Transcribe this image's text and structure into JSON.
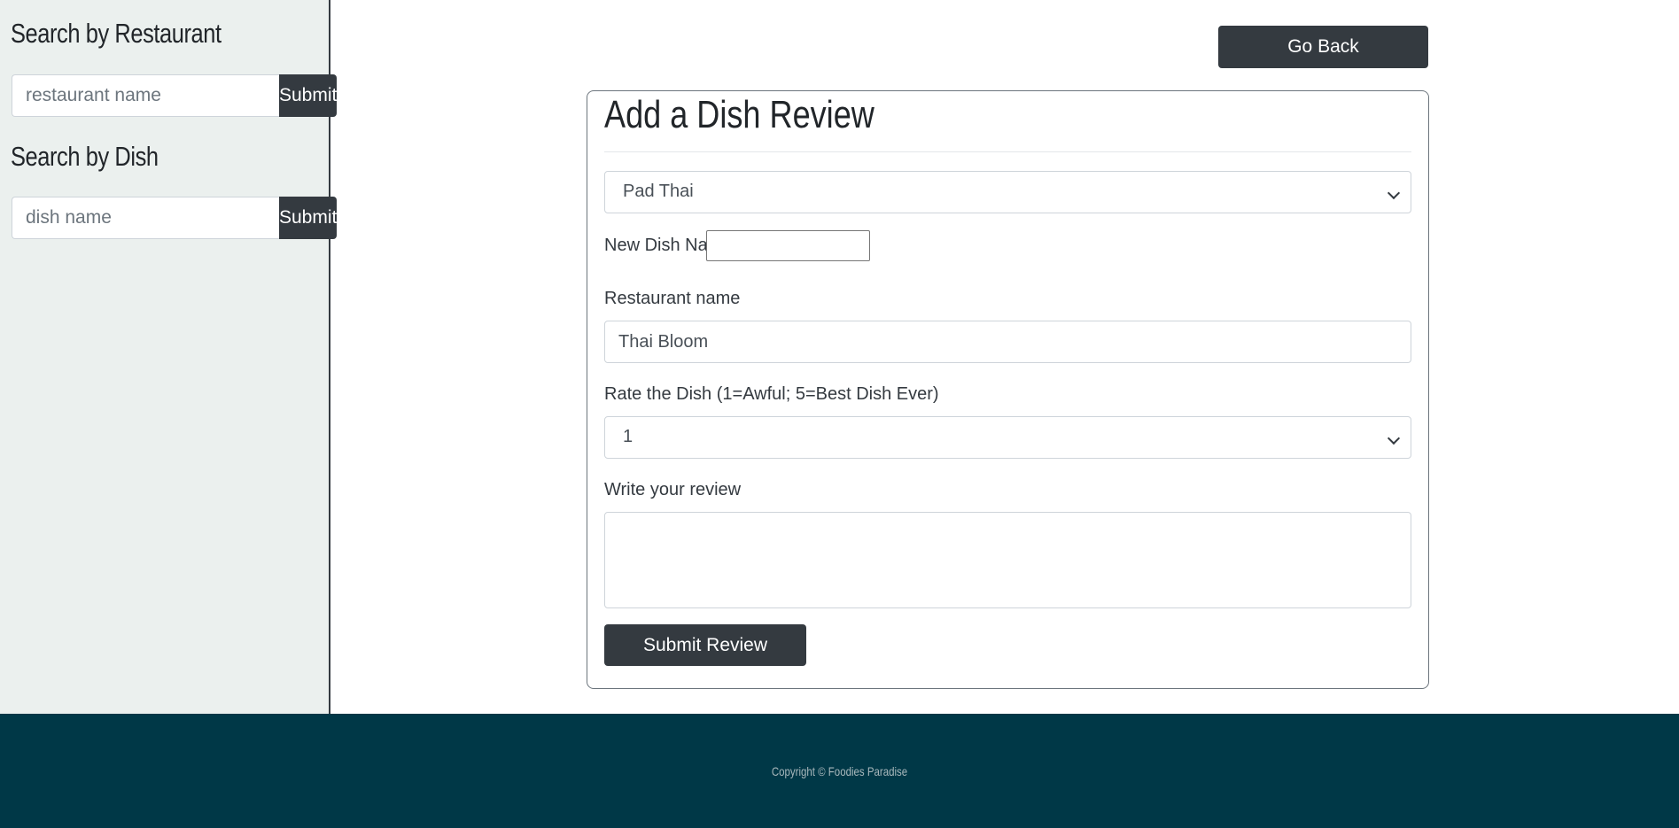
{
  "sidebar": {
    "restaurant_search": {
      "title": "Search by Restaurant",
      "placeholder": "restaurant name",
      "button_label": "Submit"
    },
    "dish_search": {
      "title": "Search by Dish",
      "placeholder": "dish name",
      "button_label": "Submit"
    }
  },
  "header": {
    "go_back_label": "Go Back"
  },
  "form": {
    "title": "Add a Dish Review",
    "dish_select": {
      "selected": "Pad Thai"
    },
    "new_dish_label": "New Dish Name:",
    "new_dish_value": "",
    "restaurant_label": "Restaurant name",
    "restaurant_value": "Thai Bloom",
    "rating_label": "Rate the Dish (1=Awful; 5=Best Dish Ever)",
    "rating_select": {
      "selected": "1"
    },
    "review_label": "Write your review",
    "review_value": "",
    "submit_label": "Submit Review"
  },
  "footer": {
    "copyright": "Copyright © Foodies Paradise"
  },
  "colors": {
    "sidebar_bg": "#ebf0ee",
    "button_dark": "#343a40",
    "footer_bg": "#003847",
    "footer_text": "#a9b8bc"
  },
  "icons": {
    "select_chevron": "chevron-down-icon",
    "textarea_grip": "resize-grip-icon"
  }
}
